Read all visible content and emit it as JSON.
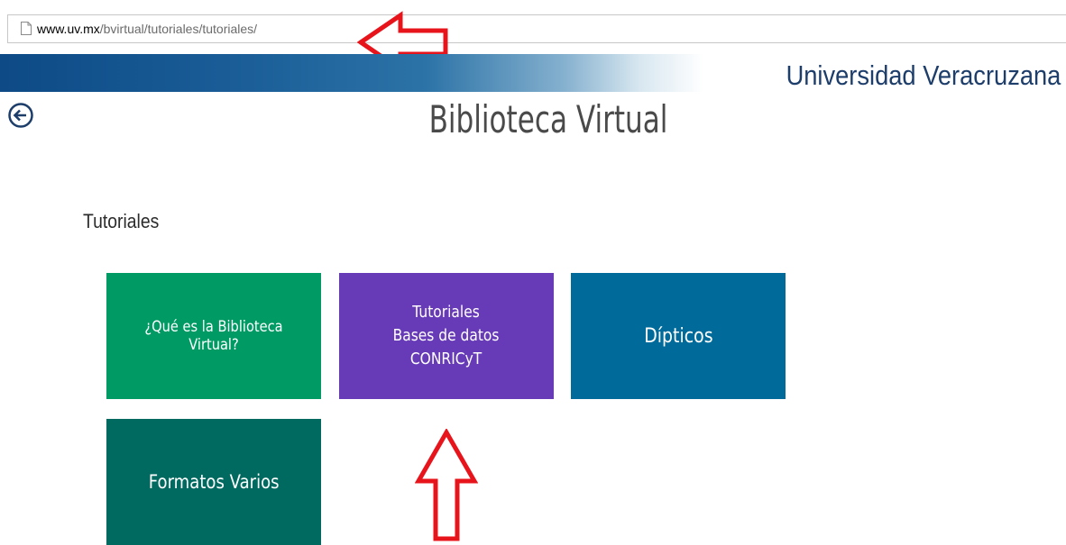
{
  "browser": {
    "url_host": "www.uv.mx",
    "url_path": "/bvirtual/tutoriales/tutoriales/"
  },
  "header": {
    "university_name": "Universidad Veracruzana",
    "page_title": "Biblioteca Virtual"
  },
  "main": {
    "section_label": "Tutoriales",
    "tiles": [
      {
        "lines": [
          "¿Qué es la Biblioteca Virtual?"
        ],
        "color": "#009a64"
      },
      {
        "lines": [
          "Tutoriales",
          "Bases de datos",
          "CONRICyT"
        ],
        "color": "#673ab7"
      },
      {
        "lines": [
          "Dípticos"
        ],
        "color": "#006b9a"
      },
      {
        "lines": [
          "Formatos Varios"
        ],
        "color": "#006a60"
      }
    ]
  },
  "icons": {
    "back": "back-arrow-icon",
    "page": "page-icon",
    "annotation": "red-outline-arrow"
  },
  "colors": {
    "banner_dark": "#0d4a86",
    "title_text": "#1d3d6a",
    "annotation_red": "#e8141c"
  }
}
